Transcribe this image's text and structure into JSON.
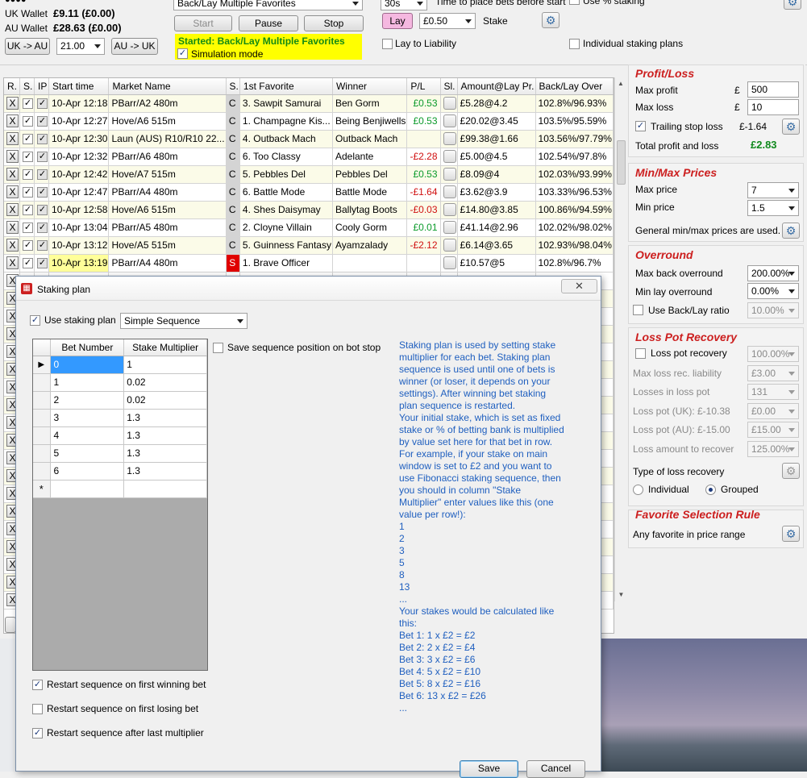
{
  "top": {
    "uk_wallet_label": "UK Wallet",
    "uk_wallet_value": "£9.11 (£0.00)",
    "au_wallet_label": "AU Wallet",
    "au_wallet_value": "£28.63 (£0.00)",
    "uk_au_btn": "UK -> AU",
    "exchange_rate": "21.00",
    "au_uk_btn": "AU -> UK",
    "strategy": "Back/Lay Multiple Favorites",
    "start_btn": "Start",
    "pause_btn": "Pause",
    "stop_btn": "Stop",
    "status_text": "Started: Back/Lay Multiple Favorites",
    "simulation_label": "Simulation mode",
    "secs_value": "30s",
    "time_label": "Time to place bets before start",
    "lay_btn": "Lay",
    "stake_value": "£0.50",
    "stake_label": "Stake",
    "pct_staking_label": "Use % staking",
    "lay_to_liability_label": "Lay to Liability",
    "individual_staking_label": "Individual staking plans"
  },
  "grid": {
    "headers": [
      "R.",
      "S.",
      "IP",
      "Start time",
      "Market Name",
      "S.",
      "1st Favorite",
      "Winner",
      "P/L",
      "Sl.",
      "Amount@Lay Pr.",
      "Back/Lay Over"
    ],
    "rows": [
      {
        "x": "X",
        "start": "10-Apr 12:18",
        "market": "PBarr/A2 480m",
        "s": "C",
        "fav": "3. Sawpit Samurai",
        "winner": "Ben Gorm",
        "pl": "£0.53",
        "amount": "£5.28@4.2",
        "over": "102.8%/96.93%"
      },
      {
        "x": "X",
        "start": "10-Apr 12:27",
        "market": "Hove/A6 515m",
        "s": "C",
        "fav": "1. Champagne Kis...",
        "winner": "Being Benjiwells",
        "pl": "£0.53",
        "amount": "£20.02@3.45",
        "over": "103.5%/95.59%"
      },
      {
        "x": "X",
        "start": "10-Apr 12:30",
        "market": "Laun (AUS)  R10/R10 22...",
        "s": "C",
        "fav": "4. Outback Mach",
        "winner": "Outback Mach",
        "pl": "",
        "amount": "£99.38@1.66",
        "over": "103.56%/97.79%"
      },
      {
        "x": "X",
        "start": "10-Apr 12:32",
        "market": "PBarr/A6 480m",
        "s": "C",
        "fav": "6. Too Classy",
        "winner": "Adelante",
        "pl": "-£2.28",
        "amount": "£5.00@4.5",
        "over": "102.54%/97.8%"
      },
      {
        "x": "X",
        "start": "10-Apr 12:42",
        "market": "Hove/A7 515m",
        "s": "C",
        "fav": "5. Pebbles Del",
        "winner": "Pebbles Del",
        "pl": "£0.53",
        "amount": "£8.09@4",
        "over": "102.03%/93.99%"
      },
      {
        "x": "X",
        "start": "10-Apr 12:47",
        "market": "PBarr/A4 480m",
        "s": "C",
        "fav": "6. Battle Mode",
        "winner": "Battle Mode",
        "pl": "-£1.64",
        "amount": "£3.62@3.9",
        "over": "103.33%/96.53%"
      },
      {
        "x": "X",
        "start": "10-Apr 12:58",
        "market": "Hove/A6 515m",
        "s": "C",
        "fav": "4. Shes Daisymay",
        "winner": "Ballytag Boots",
        "pl": "-£0.03",
        "amount": "£14.80@3.85",
        "over": "100.86%/94.59%"
      },
      {
        "x": "X",
        "start": "10-Apr 13:04",
        "market": "PBarr/A5 480m",
        "s": "C",
        "fav": "2. Cloyne Villain",
        "winner": "Cooly Gorm",
        "pl": "£0.01",
        "amount": "£41.14@2.96",
        "over": "102.02%/98.02%"
      },
      {
        "x": "X",
        "start": "10-Apr 13:12",
        "market": "Hove/A5 515m",
        "s": "C",
        "fav": "5. Guinness Fantasy",
        "winner": "Ayamzalady",
        "pl": "-£2.12",
        "amount": "£6.14@3.65",
        "over": "102.93%/98.04%"
      },
      {
        "x": "X",
        "start": "10-Apr 13:19",
        "market": "PBarr/A4 480m",
        "s": "S",
        "fav": "1. Brave Officer",
        "winner": "",
        "pl": "",
        "amount": "£10.57@5",
        "over": "102.8%/96.7%"
      }
    ]
  },
  "right": {
    "profit_title": "Profit/Loss",
    "max_profit_label": "Max profit",
    "max_profit_cur": "£",
    "max_profit_value": "500",
    "max_loss_label": "Max loss",
    "max_loss_cur": "£",
    "max_loss_value": "10",
    "trailing_label": "Trailing stop loss",
    "trailing_value": "£-1.64",
    "total_label": "Total profit and loss",
    "total_value": "£2.83",
    "minmax_title": "Min/Max Prices",
    "max_price_label": "Max price",
    "max_price_value": "7",
    "min_price_label": "Min price",
    "min_price_value": "1.5",
    "general_minmax_label": "General min/max prices are used.",
    "overround_title": "Overround",
    "max_back_label": "Max back overround",
    "max_back_value": "200.00%",
    "min_lay_label": "Min lay overround",
    "min_lay_value": "0.00%",
    "use_ratio_label": "Use Back/Lay ratio",
    "use_ratio_value": "10.00%",
    "loss_title": "Loss Pot Recovery",
    "loss_pot_label": "Loss pot recovery",
    "loss_pot_value": "100.00%",
    "max_loss_rec_label": "Max loss rec. liability",
    "max_loss_rec_value": "£3.00",
    "losses_label": "Losses in loss pot",
    "losses_value": "131",
    "loss_uk_label": "Loss pot (UK):",
    "loss_uk_amount": "£-10.38",
    "loss_uk_value": "£0.00",
    "loss_au_label": "Loss pot (AU):",
    "loss_au_amount": "£-15.00",
    "loss_au_value": "£15.00",
    "loss_amount_label": "Loss amount to recover",
    "loss_amount_value": "125.00%",
    "type_recovery_label": "Type of loss recovery",
    "individual_label": "Individual",
    "grouped_label": "Grouped",
    "fav_title": "Favorite Selection Rule",
    "fav_rule_label": "Any favorite in price range"
  },
  "dialog": {
    "title": "Staking plan",
    "use_label": "Use staking plan",
    "plan_value": "Simple Sequence",
    "save_pos_label": "Save sequence position on bot stop",
    "col_bet": "Bet Number",
    "col_mult": "Stake Multiplier",
    "rows": [
      {
        "bet": "0",
        "mult": "1"
      },
      {
        "bet": "1",
        "mult": "0.02"
      },
      {
        "bet": "2",
        "mult": "0.02"
      },
      {
        "bet": "3",
        "mult": "1.3"
      },
      {
        "bet": "4",
        "mult": "1.3"
      },
      {
        "bet": "5",
        "mult": "1.3"
      },
      {
        "bet": "6",
        "mult": "1.3"
      }
    ],
    "new_row_marker": "*",
    "restart_win_label": "Restart sequence on first winning bet",
    "restart_lose_label": "Restart sequence on first losing bet",
    "restart_last_label": "Restart sequence after last multiplier",
    "save_btn": "Save",
    "cancel_btn": "Cancel",
    "info_text": "Staking plan is used by setting stake\nmultiplier for each bet. Staking plan\nsequence is used until one of bets is\nwinner (or loser, it depends on your\nsettings). After winning bet staking\nplan sequence is restarted.\nYour initial stake, which is set as fixed\nstake or % of betting bank is multiplied\nby value set here for that bet in row.\nFor example, if your stake on main\nwindow is set to £2 and you want to\nuse Fibonacci staking sequence, then\nyou should in column \"Stake\nMultiplier\" enter values like this (one\nvalue per row!):\n1\n2\n3\n5\n8\n13\n...\nYour stakes would be calculated like\nthis:\nBet 1:   1 x £2 =  £2\nBet 2:   2 x £2 =  £4\nBet 3:   3 x £2 =  £6\nBet 4:   5 x £2 = £10\nBet 5:   8 x £2 = £16\nBet 6: 13 x £2 = £26\n..."
  },
  "colors": {
    "section_title": "#cc1f1f",
    "status_bg": "#ffff00",
    "status_text": "#138a13",
    "info_text": "#1f5fbf"
  }
}
